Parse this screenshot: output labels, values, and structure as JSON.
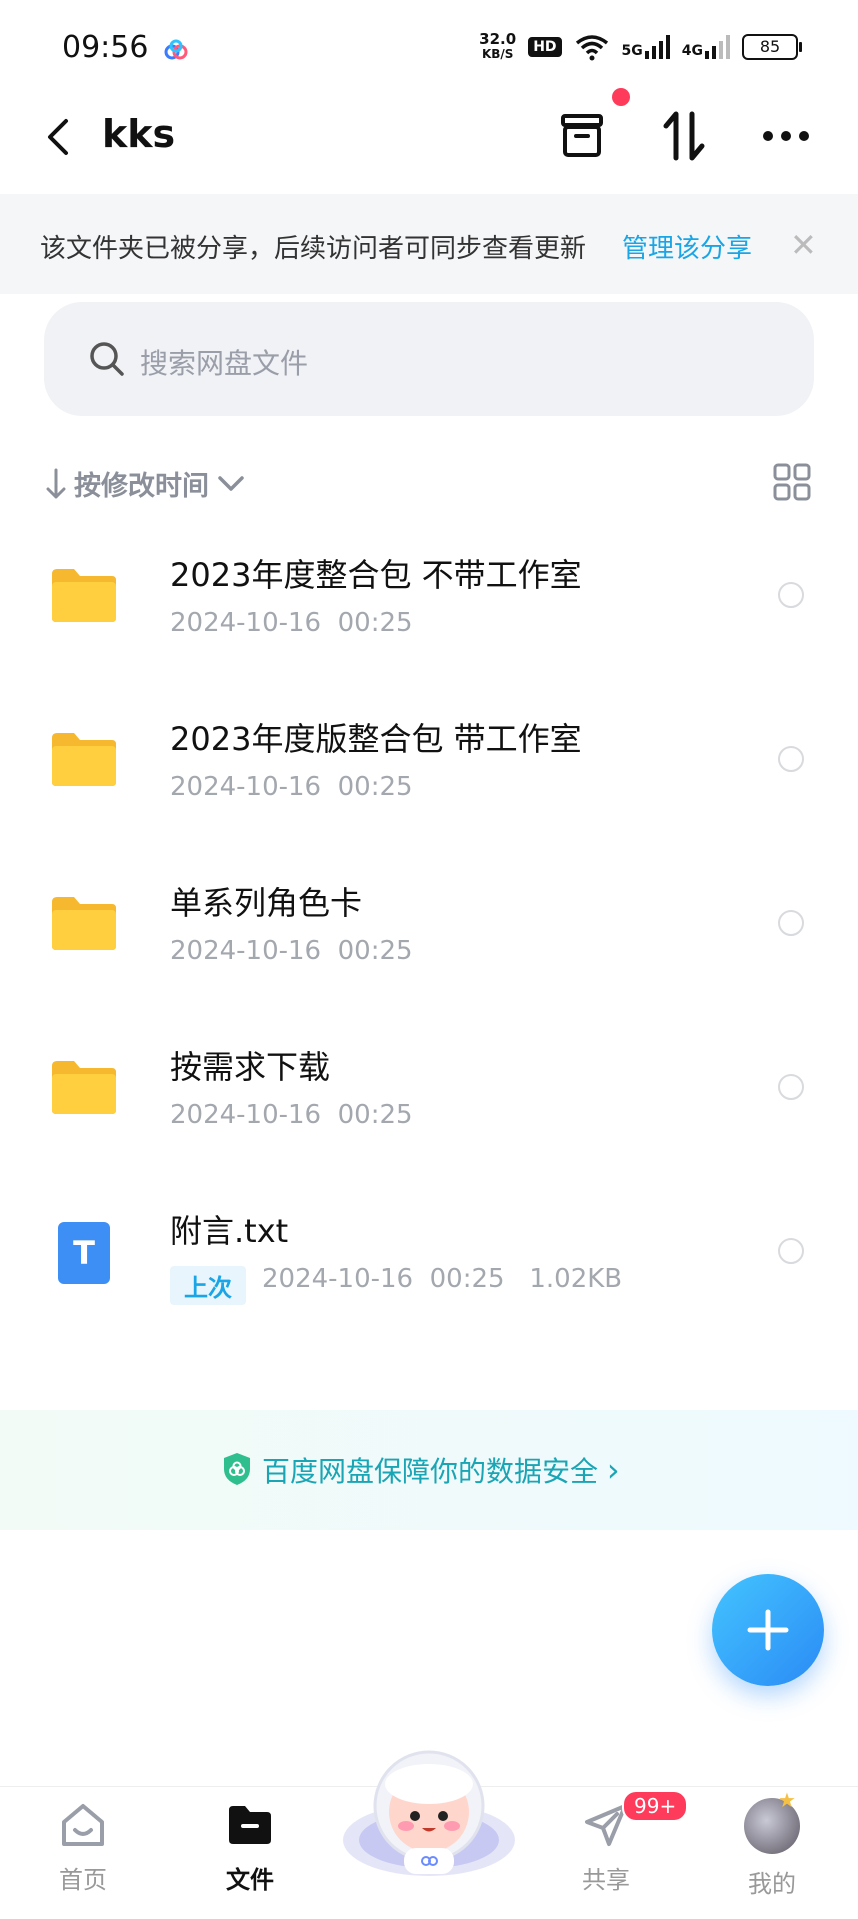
{
  "status_bar": {
    "time": "09:56",
    "speed_value": "32.0",
    "speed_unit": "KB/S",
    "hd_label": "HD",
    "net_5g": "5G",
    "net_4g": "4G",
    "battery": "85"
  },
  "header": {
    "title": "kks",
    "back_icon": "chevron-left-icon",
    "actions": [
      "archive-icon",
      "sort-transfer-icon",
      "more-icon"
    ]
  },
  "share_banner": {
    "message": "该文件夹已被分享，后续访问者可同步查看更新",
    "link_label": "管理该分享",
    "close_icon": "✕"
  },
  "search": {
    "placeholder": "搜索网盘文件"
  },
  "sort": {
    "label": "按修改时间"
  },
  "files": [
    {
      "name": "2023年度整合包 不带工作室",
      "meta": "2024-10-16  00:25",
      "type": "folder"
    },
    {
      "name": "2023年度版整合包 带工作室",
      "meta": "2024-10-16  00:25",
      "type": "folder"
    },
    {
      "name": "单系列角色卡",
      "meta": "2024-10-16  00:25",
      "type": "folder"
    },
    {
      "name": "按需求下载",
      "meta": "2024-10-16  00:25",
      "type": "folder"
    },
    {
      "name": "附言.txt",
      "tag": "上次",
      "meta": "2024-10-16  00:25   1.02KB",
      "type": "txt",
      "icon_letter": "T"
    }
  ],
  "security_banner": {
    "text": "百度网盘保障你的数据安全",
    "arrow": "›"
  },
  "bottom_nav": {
    "items": [
      {
        "label": "首页",
        "icon": "home-icon"
      },
      {
        "label": "文件",
        "icon": "folder-icon"
      },
      {
        "label": "共享",
        "icon": "send-icon",
        "badge": "99+"
      },
      {
        "label": "我的",
        "icon": "avatar"
      }
    ]
  },
  "colors": {
    "accent": "#1aa5e6",
    "folder": "#ffc93c",
    "badge": "#ff3b5c"
  }
}
